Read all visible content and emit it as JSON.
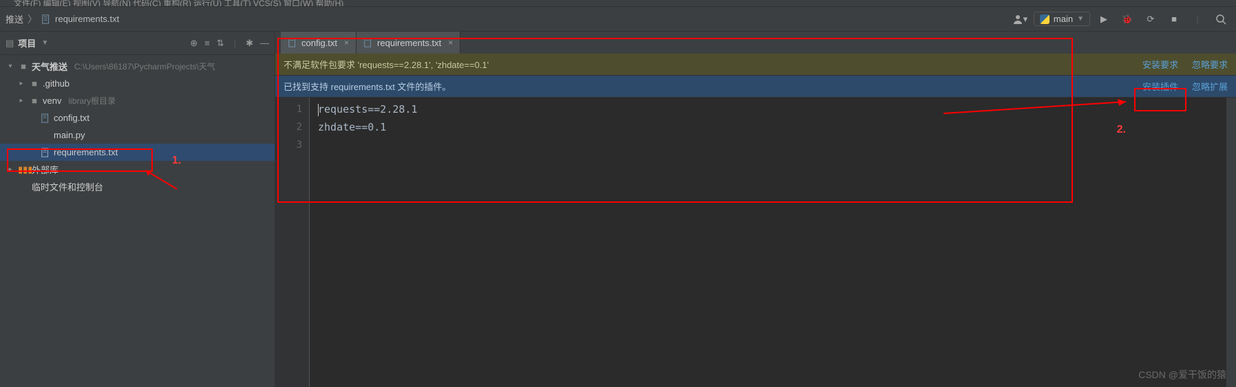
{
  "menubar": {
    "items_hint": "文件(F)  编辑(E)  视图(V)  导航(N)  代码(C)  重构(R)  运行(U)  工具(T)  VCS(S)  窗口(W)  帮助(H)"
  },
  "navbar": {
    "crumb_root": "推送",
    "crumb_file": "requirements.txt",
    "run_config": "main"
  },
  "project": {
    "title": "项目",
    "root": {
      "name": "天气推送",
      "path": "C:\\Users\\86187\\PycharmProjects\\天气"
    },
    "children": [
      {
        "type": "folder",
        "name": ".github"
      },
      {
        "type": "folder",
        "name": "venv",
        "hint": "library根目录"
      },
      {
        "type": "file",
        "name": "config.txt",
        "icon": "text"
      },
      {
        "type": "file",
        "name": "main.py",
        "icon": "py"
      },
      {
        "type": "file",
        "name": "requirements.txt",
        "icon": "text",
        "selected": true
      }
    ],
    "external_libs": "外部库",
    "scratches": "临时文件和控制台"
  },
  "tabs": [
    {
      "label": "config.txt",
      "active": false
    },
    {
      "label": "requirements.txt",
      "active": true
    }
  ],
  "banner_requirements": {
    "text": "不满足软件包要求 'requests==2.28.1', 'zhdate==0.1'",
    "action_install": "安装要求",
    "action_ignore": "忽略要求"
  },
  "banner_plugin": {
    "text": "已找到支持 requirements.txt 文件的插件。",
    "action_install": "安装插件",
    "action_ignore": "忽略扩展"
  },
  "code": {
    "lines": [
      "requests==2.28.1",
      "zhdate==0.1",
      ""
    ]
  },
  "annotations": {
    "label1": "1.",
    "label2": "2."
  },
  "watermark": "CSDN @爱干饭的猿"
}
